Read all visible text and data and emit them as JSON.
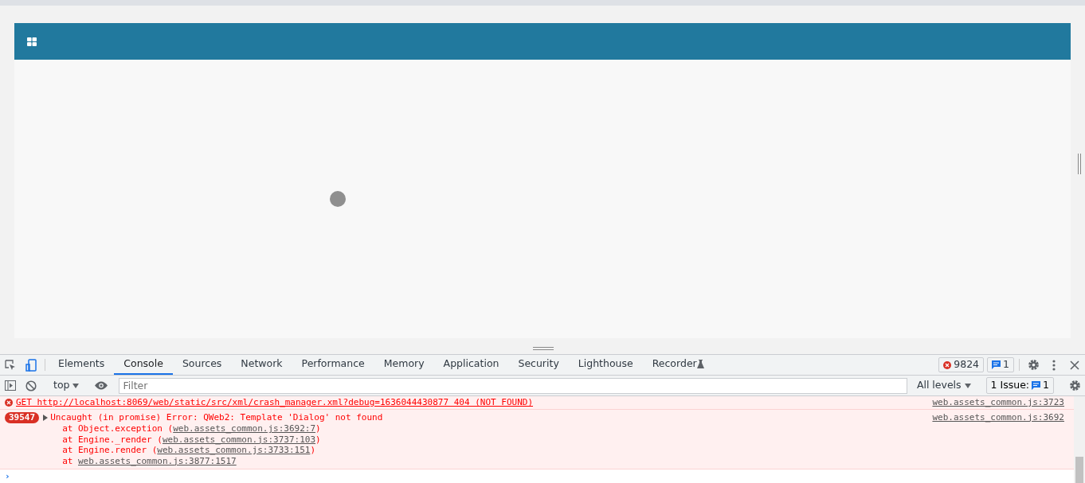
{
  "devtools": {
    "tabs": [
      {
        "label": "Elements",
        "selected": false
      },
      {
        "label": "Console",
        "selected": true
      },
      {
        "label": "Sources",
        "selected": false
      },
      {
        "label": "Network",
        "selected": false
      },
      {
        "label": "Performance",
        "selected": false
      },
      {
        "label": "Memory",
        "selected": false
      },
      {
        "label": "Application",
        "selected": false
      },
      {
        "label": "Security",
        "selected": false
      },
      {
        "label": "Lighthouse",
        "selected": false
      },
      {
        "label": "Recorder",
        "selected": false
      }
    ],
    "error_count": "9824",
    "message_count": "1",
    "context": "top",
    "filter": {
      "placeholder": "Filter"
    },
    "levels": "All levels",
    "issues_label": "1 Issue:",
    "issues_count": "1"
  },
  "console": [
    {
      "kind": "request",
      "text": "GET http://localhost:8069/web/static/src/xml/crash_manager.xml?debug=1636044430877 404 (NOT FOUND)",
      "source": "web.assets_common.js:3723"
    },
    {
      "kind": "error",
      "repeat": "39547",
      "text": "Uncaught (in promise) Error: QWeb2: Template 'Dialog' not found",
      "source": "web.assets_common.js:3692",
      "stack": [
        {
          "prefix": "at Object.exception (",
          "link": "web.assets_common.js:3692:7",
          "suffix": ")"
        },
        {
          "prefix": "at Engine._render (",
          "link": "web.assets_common.js:3737:103",
          "suffix": ")"
        },
        {
          "prefix": "at Engine.render (",
          "link": "web.assets_common.js:3733:151",
          "suffix": ")"
        },
        {
          "prefix": "at ",
          "link": "web.assets_common.js:3877:1517"
        }
      ]
    }
  ],
  "prompt": "›"
}
